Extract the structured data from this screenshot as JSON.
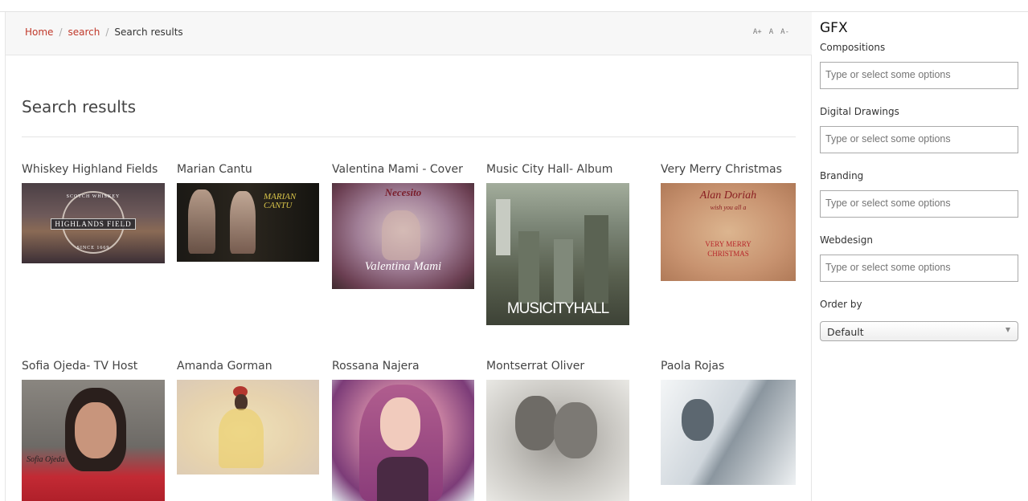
{
  "breadcrumb": {
    "home": "Home",
    "search": "search",
    "current": "Search results",
    "separator": "/"
  },
  "font_controls": {
    "increase": "A+",
    "normal": "A",
    "decrease": "A-"
  },
  "page_title": "Search results",
  "results": [
    {
      "title": "Whiskey Highland Fields",
      "image_text_top": "SCOTCH WHISKEY",
      "image_text_main": "HIGHLANDS FIELD",
      "image_text_bottom": "SINCE 1669"
    },
    {
      "title": "Marian Cantu",
      "image_text_main": "MARIAN CANTU"
    },
    {
      "title": "Valentina Mami - Cover",
      "image_text_top": "Necesito",
      "image_text_main": "Valentina Mami"
    },
    {
      "title": "Music City Hall- Album",
      "image_text_main": "MUSICITYHALL"
    },
    {
      "title": "Very Merry Christmas",
      "image_text_top": "Alan Doriah",
      "image_text_sub": "wish you all a",
      "image_text_main": "VERY MERRY CHRISTMAS"
    },
    {
      "title": "Sofia Ojeda- TV Host",
      "image_text_main": "Sofia Ojeda"
    },
    {
      "title": "Amanda Gorman"
    },
    {
      "title": "Rossana Najera"
    },
    {
      "title": "Montserrat Oliver"
    },
    {
      "title": "Paola Rojas"
    }
  ],
  "sidebar": {
    "title": "GFX",
    "filters": [
      {
        "label": "Compositions",
        "placeholder": "Type or select some options"
      },
      {
        "label": "Digital Drawings",
        "placeholder": "Type or select some options"
      },
      {
        "label": "Branding",
        "placeholder": "Type or select some options"
      },
      {
        "label": "Webdesign",
        "placeholder": "Type or select some options"
      }
    ],
    "order_label": "Order by",
    "order_value": "Default"
  },
  "colors": {
    "link": "#c0392b",
    "text": "#333333",
    "border": "#aaaaaa"
  }
}
